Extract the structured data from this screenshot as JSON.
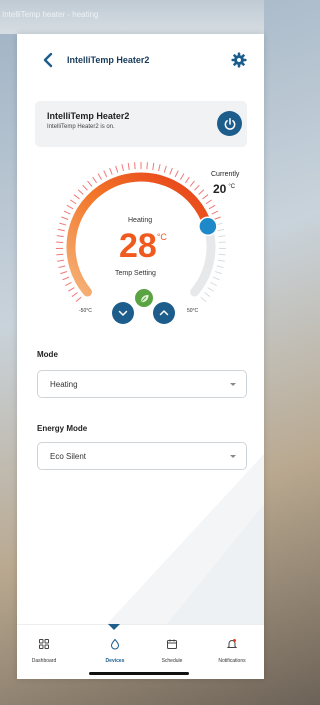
{
  "window": {
    "title": "IntelliTemp heater - heating"
  },
  "header": {
    "title": "IntelliTemp Heater2"
  },
  "status_card": {
    "title": "IntelliTemp Heater2",
    "subtitle": "IntelliTemp Heater2 is on."
  },
  "thermostat": {
    "current_label": "Currently",
    "current_value": "20",
    "current_unit": "°C",
    "state_label": "Heating",
    "setpoint": "28",
    "setpoint_unit": "°C",
    "setpoint_caption": "Temp Setting",
    "min_label": "-50°C",
    "max_label": "50°C"
  },
  "mode": {
    "label": "Mode",
    "value": "Heating"
  },
  "energy_mode": {
    "label": "Energy Mode",
    "value": "Eco Silent"
  },
  "nav": {
    "items": [
      {
        "label": "Dashboard",
        "icon": "grid-icon"
      },
      {
        "label": "Devices",
        "icon": "droplet-icon",
        "active": true
      },
      {
        "label": "Schedule",
        "icon": "calendar-icon"
      },
      {
        "label": "Notifications",
        "icon": "bell-icon"
      }
    ]
  },
  "colors": {
    "primary": "#1d5d8c",
    "accent": "#f05a1e",
    "eco": "#5aa342"
  }
}
